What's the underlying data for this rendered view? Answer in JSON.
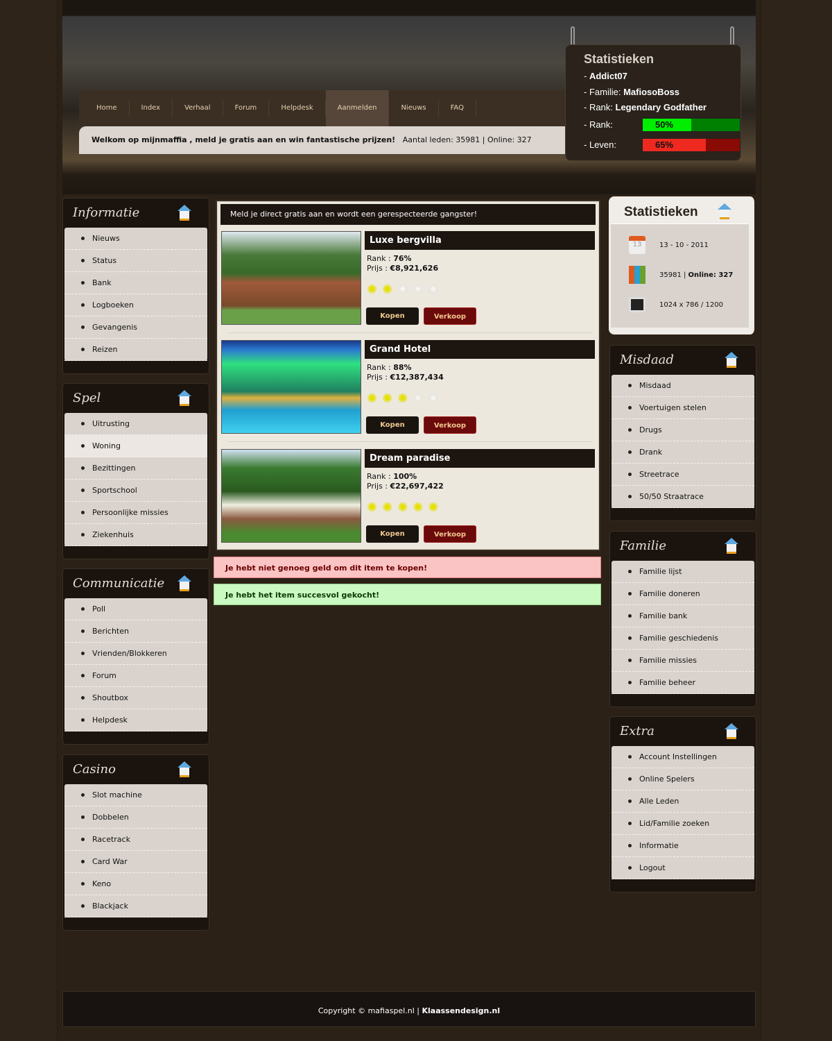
{
  "nav": [
    "Home",
    "Index",
    "Verhaal",
    "Forum",
    "Helpdesk",
    "Aanmelden",
    "Nieuws",
    "FAQ"
  ],
  "nav_active": 5,
  "welcome": {
    "text": "Welkom op mijnmaffia , meld je gratis aan en win fantastische prijzen!",
    "members": "Aantal leden: 35981 | Online: 327"
  },
  "player": {
    "title": "Statistieken",
    "name_prefix": "- ",
    "name": "Addict07",
    "family_label": "- Familie: ",
    "family": "MafiosoBoss",
    "rank_label": "- Rank: ",
    "rank": "Legendary Godfather",
    "rank_bar_label": "- Rank:",
    "rank_pct": 50,
    "rank_pct_text": "50%",
    "life_label": "- Leven:",
    "life_pct": 65,
    "life_pct_text": "65%",
    "colors": {
      "rank": "#00ee00",
      "life": "#ee2a20"
    }
  },
  "left_panels": [
    {
      "title": "Informatie",
      "items": [
        "Nieuws",
        "Status",
        "Bank",
        "Logboeken",
        "Gevangenis",
        "Reizen"
      ]
    },
    {
      "title": "Spel",
      "items": [
        "Uitrusting",
        "Woning",
        "Bezittingen",
        "Sportschool",
        "Persoonlijke missies",
        "Ziekenhuis"
      ],
      "highlight": 1
    },
    {
      "title": "Communicatie",
      "items": [
        "Poll",
        "Berichten",
        "Vrienden/Blokkeren",
        "Forum",
        "Shoutbox",
        "Helpdesk"
      ]
    },
    {
      "title": "Casino",
      "items": [
        "Slot machine",
        "Dobbelen",
        "Racetrack",
        "Card War",
        "Keno",
        "Blackjack"
      ]
    }
  ],
  "right_panels": [
    {
      "title": "Misdaad",
      "items": [
        "Misdaad",
        "Voertuigen stelen",
        "Drugs",
        "Drank",
        "Streetrace",
        "50/50 Straatrace"
      ]
    },
    {
      "title": "Familie",
      "items": [
        "Familie lijst",
        "Familie doneren",
        "Familie bank",
        "Familie geschiedenis",
        "Familie missies",
        "Familie beheer"
      ]
    },
    {
      "title": "Extra",
      "items": [
        "Account Instellingen",
        "Online Spelers",
        "Alle Leden",
        "Lid/Familie zoeken",
        "Informatie",
        "Logout"
      ]
    }
  ],
  "site_stats": {
    "title": "Statistieken",
    "date": "13 - 10 - 2011",
    "members": "35981 | ",
    "online": "Online: 327",
    "resolution": "1024 x 786 / 1200",
    "calendar_day": "13"
  },
  "main": {
    "intro": "Meld je direct gratis aan en wordt een gerespecteerde gangster!",
    "rank_label": "Rank : ",
    "price_label": "Prijs  : ",
    "buy": "Kopen",
    "sell": "Verkoop",
    "products": [
      {
        "name": "Luxe bergvilla",
        "rank": "76%",
        "price": "€8,921,626",
        "stars": 2
      },
      {
        "name": "Grand Hotel",
        "rank": "88%",
        "price": "€12,387,434",
        "stars": 3
      },
      {
        "name": "Dream paradise",
        "rank": "100%",
        "price": "€22,697,422",
        "stars": 5
      }
    ]
  },
  "messages": {
    "error": "Je hebt niet genoeg geld om dit item te kopen!",
    "success": "Je hebt het item succesvol gekocht!"
  },
  "footer": {
    "text": "Copyright © mafiaspel.nl | ",
    "brand": "Klaassendesign.nl"
  }
}
